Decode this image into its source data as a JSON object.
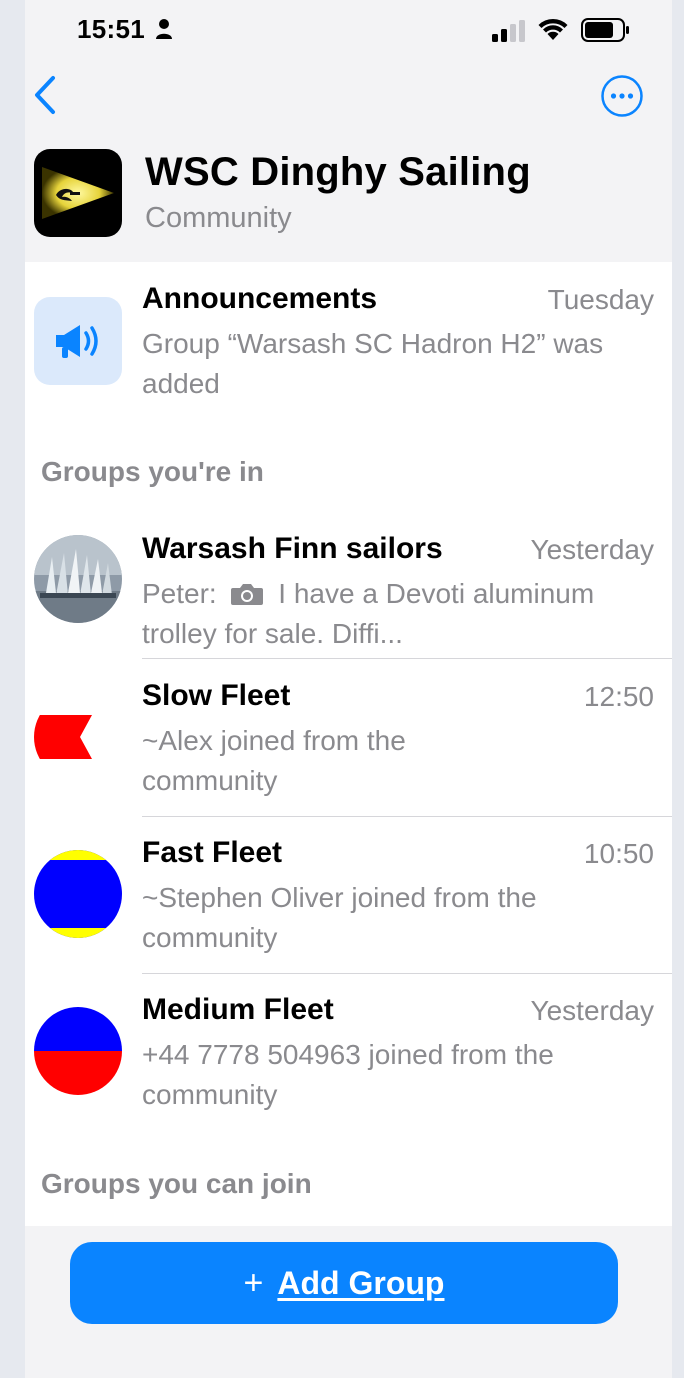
{
  "status_bar": {
    "time": "15:51"
  },
  "header": {
    "title": "WSC Dinghy Sailing",
    "subtitle": "Community"
  },
  "announcements": {
    "name": "Announcements",
    "time": "Tuesday",
    "preview": "Group “Warsash SC Hadron H2” was added"
  },
  "sections": {
    "groups_in": "Groups you're in",
    "groups_join": "Groups you can join"
  },
  "groups": [
    {
      "name": "Warsash Finn sailors",
      "time": "Yesterday",
      "sender": "Peter:",
      "preview": "I have a Devoti aluminum trolley for sale.  Diffi..."
    },
    {
      "name": "Slow Fleet",
      "time": "12:50",
      "preview": "~Alex joined from the community"
    },
    {
      "name": "Fast Fleet",
      "time": "10:50",
      "preview": "~Stephen Oliver joined from the community"
    },
    {
      "name": "Medium Fleet",
      "time": "Yesterday",
      "preview": "+44 7778 504963 joined from the community"
    }
  ],
  "add_group": {
    "plus": "+",
    "label": "Add Group"
  },
  "colors": {
    "accent": "#0a84ff",
    "secondary_text": "#8a8a8e",
    "flag_red": "#ff0000",
    "flag_blue": "#0000ff",
    "flag_yellow": "#ffff00"
  }
}
